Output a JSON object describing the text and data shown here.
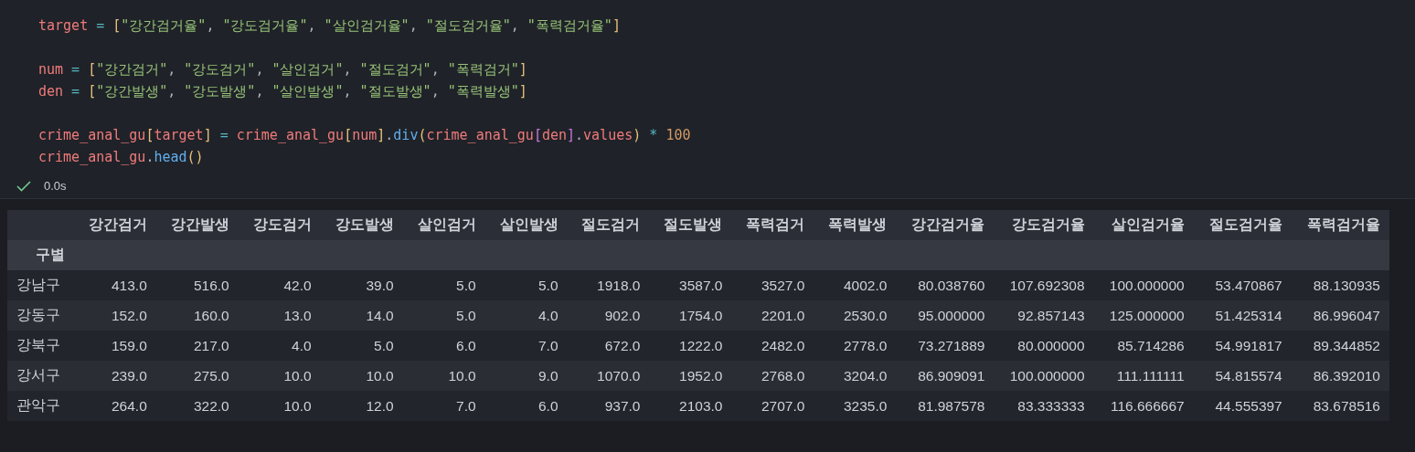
{
  "code": {
    "blocks": [
      [
        {
          "tokens": [
            {
              "kind": "var",
              "text": "target"
            },
            {
              "kind": "op",
              "text": " = "
            },
            {
              "kind": "bracket1",
              "text": "["
            },
            {
              "kind": "string",
              "text": "\"강간검거율\""
            },
            {
              "kind": "punct",
              "text": ", "
            },
            {
              "kind": "string",
              "text": "\"강도검거율\""
            },
            {
              "kind": "punct",
              "text": ", "
            },
            {
              "kind": "string",
              "text": "\"살인검거율\""
            },
            {
              "kind": "punct",
              "text": ", "
            },
            {
              "kind": "string",
              "text": "\"절도검거율\""
            },
            {
              "kind": "punct",
              "text": ", "
            },
            {
              "kind": "string",
              "text": "\"폭력검거율\""
            },
            {
              "kind": "bracket1",
              "text": "]"
            }
          ]
        }
      ],
      [
        {
          "tokens": [
            {
              "kind": "var",
              "text": "num"
            },
            {
              "kind": "op",
              "text": " = "
            },
            {
              "kind": "bracket1",
              "text": "["
            },
            {
              "kind": "string",
              "text": "\"강간검거\""
            },
            {
              "kind": "punct",
              "text": ", "
            },
            {
              "kind": "string",
              "text": "\"강도검거\""
            },
            {
              "kind": "punct",
              "text": ", "
            },
            {
              "kind": "string",
              "text": "\"살인검거\""
            },
            {
              "kind": "punct",
              "text": ", "
            },
            {
              "kind": "string",
              "text": "\"절도검거\""
            },
            {
              "kind": "punct",
              "text": ", "
            },
            {
              "kind": "string",
              "text": "\"폭력검거\""
            },
            {
              "kind": "bracket1",
              "text": "]"
            }
          ]
        },
        {
          "tokens": [
            {
              "kind": "var",
              "text": "den"
            },
            {
              "kind": "op",
              "text": " = "
            },
            {
              "kind": "bracket1",
              "text": "["
            },
            {
              "kind": "string",
              "text": "\"강간발생\""
            },
            {
              "kind": "punct",
              "text": ", "
            },
            {
              "kind": "string",
              "text": "\"강도발생\""
            },
            {
              "kind": "punct",
              "text": ", "
            },
            {
              "kind": "string",
              "text": "\"살인발생\""
            },
            {
              "kind": "punct",
              "text": ", "
            },
            {
              "kind": "string",
              "text": "\"절도발생\""
            },
            {
              "kind": "punct",
              "text": ", "
            },
            {
              "kind": "string",
              "text": "\"폭력발생\""
            },
            {
              "kind": "bracket1",
              "text": "]"
            }
          ]
        }
      ],
      [
        {
          "tokens": [
            {
              "kind": "var",
              "text": "crime_anal_gu"
            },
            {
              "kind": "bracket1",
              "text": "["
            },
            {
              "kind": "var",
              "text": "target"
            },
            {
              "kind": "bracket1",
              "text": "]"
            },
            {
              "kind": "op",
              "text": " = "
            },
            {
              "kind": "var",
              "text": "crime_anal_gu"
            },
            {
              "kind": "bracket1",
              "text": "["
            },
            {
              "kind": "var",
              "text": "num"
            },
            {
              "kind": "bracket1",
              "text": "]"
            },
            {
              "kind": "punct",
              "text": "."
            },
            {
              "kind": "func",
              "text": "div"
            },
            {
              "kind": "bracket1",
              "text": "("
            },
            {
              "kind": "var",
              "text": "crime_anal_gu"
            },
            {
              "kind": "bracket2",
              "text": "["
            },
            {
              "kind": "var",
              "text": "den"
            },
            {
              "kind": "bracket2",
              "text": "]"
            },
            {
              "kind": "punct",
              "text": "."
            },
            {
              "kind": "var",
              "text": "values"
            },
            {
              "kind": "bracket1",
              "text": ")"
            },
            {
              "kind": "op",
              "text": " * "
            },
            {
              "kind": "number",
              "text": "100"
            }
          ]
        },
        {
          "tokens": [
            {
              "kind": "var",
              "text": "crime_anal_gu"
            },
            {
              "kind": "punct",
              "text": "."
            },
            {
              "kind": "func",
              "text": "head"
            },
            {
              "kind": "bracket1",
              "text": "()"
            }
          ]
        }
      ]
    ]
  },
  "status": {
    "success": true,
    "time": "0.0s"
  },
  "table": {
    "columns": [
      "강간검거",
      "강간발생",
      "강도검거",
      "강도발생",
      "살인검거",
      "살인발생",
      "절도검거",
      "절도발생",
      "폭력검거",
      "폭력발생",
      "강간검거율",
      "강도검거율",
      "살인검거율",
      "절도검거율",
      "폭력검거율"
    ],
    "index_name": "구별",
    "rows": [
      {
        "index": "강남구",
        "cells": [
          "413.0",
          "516.0",
          "42.0",
          "39.0",
          "5.0",
          "5.0",
          "1918.0",
          "3587.0",
          "3527.0",
          "4002.0",
          "80.038760",
          "107.692308",
          "100.000000",
          "53.470867",
          "88.130935"
        ]
      },
      {
        "index": "강동구",
        "cells": [
          "152.0",
          "160.0",
          "13.0",
          "14.0",
          "5.0",
          "4.0",
          "902.0",
          "1754.0",
          "2201.0",
          "2530.0",
          "95.000000",
          "92.857143",
          "125.000000",
          "51.425314",
          "86.996047"
        ]
      },
      {
        "index": "강북구",
        "cells": [
          "159.0",
          "217.0",
          "4.0",
          "5.0",
          "6.0",
          "7.0",
          "672.0",
          "1222.0",
          "2482.0",
          "2778.0",
          "73.271889",
          "80.000000",
          "85.714286",
          "54.991817",
          "89.344852"
        ]
      },
      {
        "index": "강서구",
        "cells": [
          "239.0",
          "275.0",
          "10.0",
          "10.0",
          "10.0",
          "9.0",
          "1070.0",
          "1952.0",
          "2768.0",
          "3204.0",
          "86.909091",
          "100.000000",
          "111.111111",
          "54.815574",
          "86.392010"
        ]
      },
      {
        "index": "관악구",
        "cells": [
          "264.0",
          "322.0",
          "10.0",
          "12.0",
          "7.0",
          "6.0",
          "937.0",
          "2103.0",
          "2707.0",
          "3235.0",
          "81.987578",
          "83.333333",
          "116.666667",
          "44.555397",
          "83.678516"
        ]
      }
    ]
  }
}
